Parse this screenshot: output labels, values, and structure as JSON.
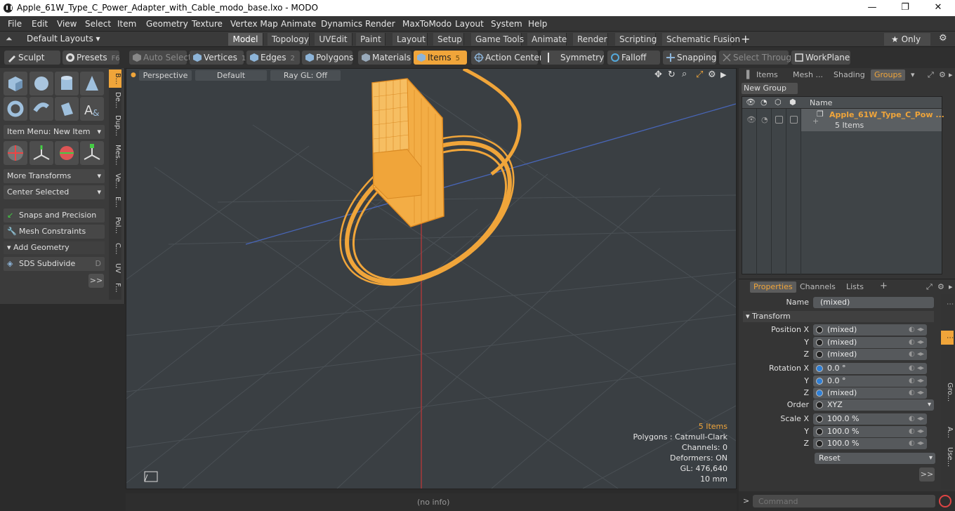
{
  "window": {
    "title": "Apple_61W_Type_C_Power_Adapter_with_Cable_modo_base.lxo - MODO",
    "minimize": "—",
    "maximize": "❐",
    "close": "✕"
  },
  "menu": [
    "File",
    "Edit",
    "View",
    "Select",
    "Item",
    "Geometry",
    "Texture",
    "Vertex Map",
    "Animate",
    "Dynamics",
    "Render",
    "MaxToModo",
    "Layout",
    "System",
    "Help"
  ],
  "layout_bar": {
    "layouts_label": "Default Layouts ▾",
    "tabs": [
      "Model",
      "Topology",
      "UVEdit",
      "Paint",
      "Layout",
      "Setup",
      "Game Tools",
      "Animate",
      "Render",
      "Scripting",
      "Schematic Fusion"
    ],
    "active_tab": "Model",
    "add": "+",
    "only_label": "★  Only",
    "gear": "⚙"
  },
  "toolbar": {
    "sculpt": "Sculpt",
    "presets": "Presets",
    "presets_key": "F6",
    "auto_select": "Auto Select",
    "vertices": "Vertices",
    "vertices_key": "1",
    "edges": "Edges",
    "edges_key": "2",
    "polygons": "Polygons",
    "materials": "Materials",
    "items": "Items",
    "items_key": "5",
    "action_center": "Action Center",
    "symmetry": "Symmetry",
    "falloff": "Falloff",
    "snapping": "Snapping",
    "select_through": "Select Through",
    "workplane": "WorkPlane"
  },
  "left_panel": {
    "item_menu": "Item Menu: New Item",
    "more_transforms": "More Transforms",
    "center_selected": "Center Selected",
    "snaps": "Snaps and Precision",
    "mesh_constraints": "Mesh Constraints",
    "add_geometry": "Add Geometry",
    "sds_subdivide": "SDS Subdivide",
    "sds_key": "D",
    "expand": ">>",
    "side_tabs": [
      "B...",
      "De...",
      "Dup...",
      "Mes...",
      "Ve...",
      "E...",
      "Pol...",
      "C...",
      "UV",
      "F..."
    ]
  },
  "viewport": {
    "perspective": "Perspective",
    "default": "Default",
    "raygl": "Ray GL: Off",
    "info_items": "5 Items",
    "info_polygons": "Polygons : Catmull-Clark",
    "info_channels": "Channels: 0",
    "info_deformers": "Deformers: ON",
    "info_gl": "GL: 476,640",
    "info_scale": "10 mm"
  },
  "status": {
    "text": "(no info)"
  },
  "right_panel": {
    "top_tabs": [
      "Items",
      "Mesh ...",
      "Shading",
      "Groups"
    ],
    "active_top_tab": "Groups",
    "new_group": "New Group",
    "col_name": "Name",
    "group_name": "Apple_61W_Type_C_Pow ...",
    "group_count": "5 Items",
    "prop_tabs": [
      "Properties",
      "Channels",
      "Lists"
    ],
    "active_prop_tab": "Properties",
    "name_label": "Name",
    "name_value": "(mixed)",
    "transform": "Transform",
    "position_x_label": "Position X",
    "position_x": "(mixed)",
    "position_y": "(mixed)",
    "position_z": "(mixed)",
    "rotation_x_label": "Rotation X",
    "rotation_x": "0.0 °",
    "rotation_y": "0.0 °",
    "rotation_z": "(mixed)",
    "order_label": "Order",
    "order_value": "XYZ",
    "scale_x_label": "Scale X",
    "scale_x": "100.0 %",
    "scale_y": "100.0 %",
    "scale_z": "100.0 %",
    "y_label": "Y",
    "z_label": "Z",
    "reset": "Reset",
    "expand": ">>",
    "side_tabs": [
      "Gro...",
      "A...",
      "Use..."
    ],
    "command_placeholder": "Command"
  },
  "colors": {
    "accent": "#f0a53a",
    "background": "#3a3f43"
  }
}
